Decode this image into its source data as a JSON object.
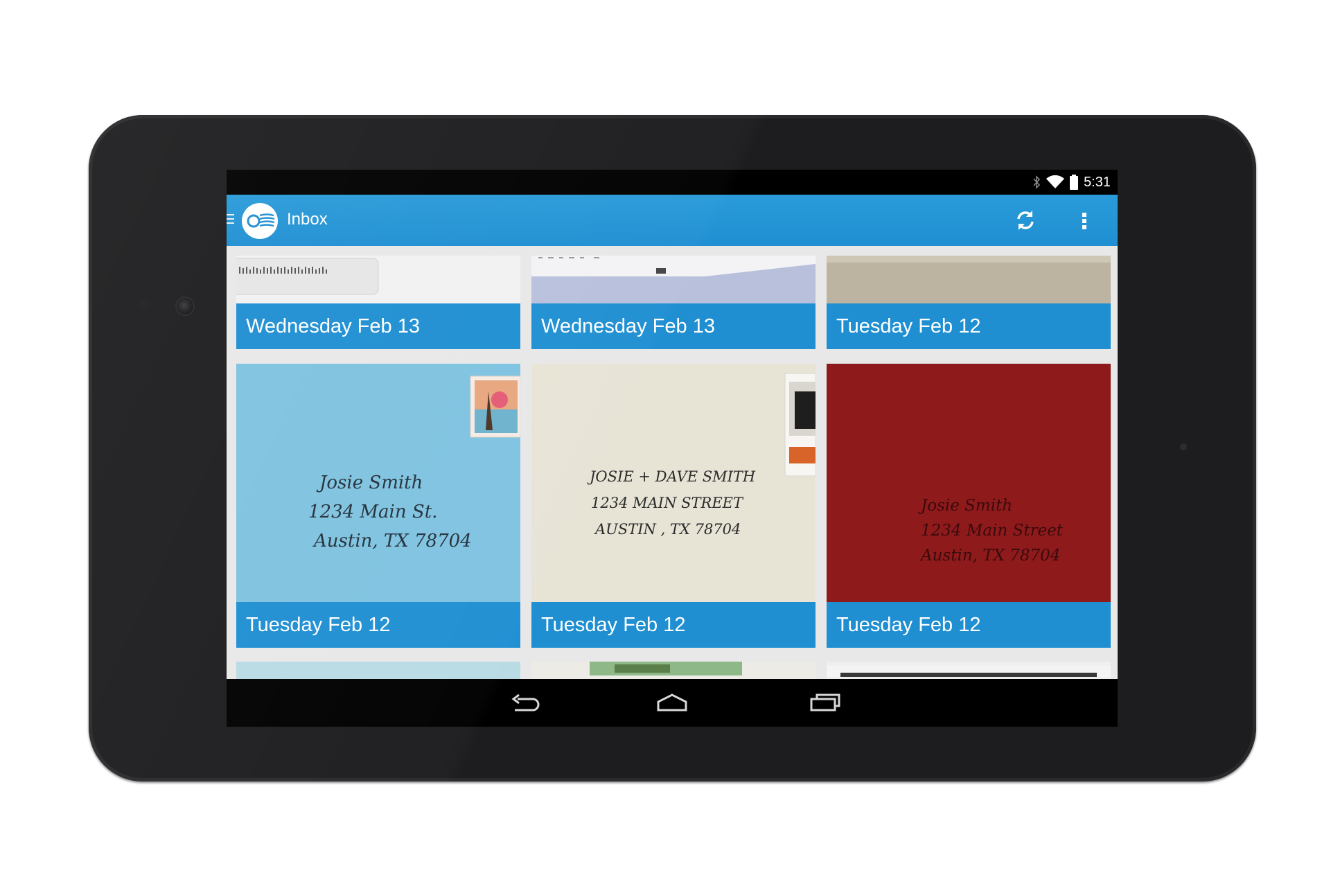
{
  "status_bar": {
    "time": "5:31",
    "icons": [
      "bluetooth-icon",
      "wifi-icon",
      "battery-icon"
    ]
  },
  "action_bar": {
    "title": "Inbox",
    "actions": [
      "refresh-icon",
      "overflow-menu-icon"
    ],
    "color": "#1f8fd2"
  },
  "mail_cards": [
    {
      "date": "Wednesday Feb 13"
    },
    {
      "date": "Wednesday Feb 13"
    },
    {
      "date": "Tuesday Feb 12"
    },
    {
      "date": "Tuesday Feb 12",
      "envelope": {
        "color": "#7fc3e0",
        "address": [
          "Josie Smith",
          "1234 Main St.",
          "Austin, TX 78704"
        ]
      }
    },
    {
      "date": "Tuesday Feb 12",
      "envelope": {
        "color": "#e7e4d6",
        "address": [
          "JOSIE + DAVE SMITH",
          "1234 MAIN STREET",
          "AUSTIN , TX 78704"
        ]
      }
    },
    {
      "date": "Tuesday Feb 12",
      "envelope": {
        "color": "#8e1a1c",
        "address": [
          "Josie Smith",
          "1234 Main Street",
          "Austin, TX 78704"
        ]
      }
    }
  ],
  "nav_bar": {
    "buttons": [
      "back-icon",
      "home-icon",
      "recents-icon"
    ]
  }
}
